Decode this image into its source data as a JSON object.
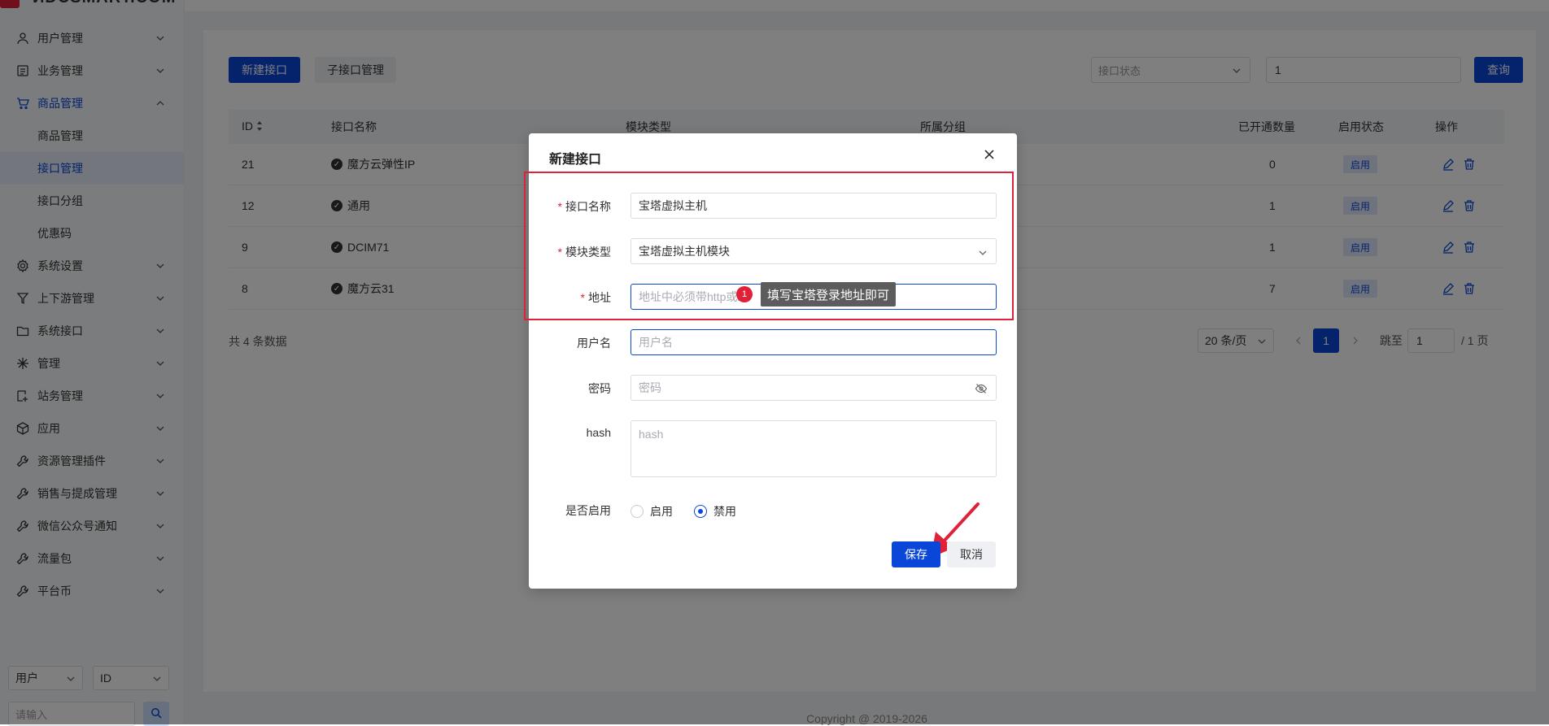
{
  "sidebar": {
    "logo_text": "ИDCSMART.COM",
    "menu": [
      {
        "label": "用户管理",
        "icon": "user-icon"
      },
      {
        "label": "业务管理",
        "icon": "document-icon"
      },
      {
        "label": "商品管理",
        "icon": "cart-icon",
        "open": true,
        "children": [
          "商品管理",
          "接口管理",
          "接口分组",
          "优惠码"
        ],
        "active_child": "接口管理"
      },
      {
        "label": "系统设置",
        "icon": "settings-icon"
      },
      {
        "label": "上下游管理",
        "icon": "filter-icon"
      },
      {
        "label": "系统接口",
        "icon": "folder-icon"
      },
      {
        "label": "管理",
        "icon": "sparkle-icon"
      },
      {
        "label": "站务管理",
        "icon": "site-icon"
      },
      {
        "label": "应用",
        "icon": "box-icon"
      },
      {
        "label": "资源管理插件",
        "icon": "wrench-icon"
      },
      {
        "label": "销售与提成管理",
        "icon": "wrench-icon"
      },
      {
        "label": "微信公众号通知",
        "icon": "wrench-icon"
      },
      {
        "label": "流量包",
        "icon": "wrench-icon"
      },
      {
        "label": "平台币",
        "icon": "wrench-icon"
      }
    ],
    "search_type": "用户",
    "search_field": "ID",
    "search_placeholder": "请输入"
  },
  "toolbar": {
    "new_button": "新建接口",
    "sub_button": "子接口管理",
    "status_placeholder": "接口状态",
    "keyword_value": "1",
    "query_button": "查询"
  },
  "table": {
    "headers": [
      "ID",
      "接口名称",
      "模块类型",
      "所属分组",
      "已开通数量",
      "启用状态",
      "操作"
    ],
    "rows": [
      {
        "id": "21",
        "name": "魔方云弹性IP",
        "count": "0",
        "status": "启用"
      },
      {
        "id": "12",
        "name": "通用",
        "count": "1",
        "status": "启用"
      },
      {
        "id": "9",
        "name": "DCIM71",
        "count": "1",
        "status": "启用"
      },
      {
        "id": "8",
        "name": "魔方云31",
        "count": "7",
        "status": "启用"
      }
    ],
    "total": "共 4 条数据",
    "page_size": "20 条/页",
    "current_page": "1",
    "jump_label": "跳至",
    "jump_value": "1",
    "page_total": "/ 1 页"
  },
  "copyright": "Copyright @ 2019-2026",
  "modal": {
    "title": "新建接口",
    "fields": {
      "name_label": "接口名称",
      "name_value": "宝塔虚拟主机",
      "module_label": "模块类型",
      "module_value": "宝塔虚拟主机模块",
      "address_label": "地址",
      "address_placeholder": "地址中必须带http或h",
      "username_label": "用户名",
      "username_placeholder": "用户名",
      "password_label": "密码",
      "password_placeholder": "密码",
      "hash_label": "hash",
      "hash_placeholder": "hash",
      "enable_label": "是否启用",
      "enable_option": "启用",
      "disable_option": "禁用"
    },
    "save_button": "保存",
    "cancel_button": "取消",
    "tooltip": "填写宝塔登录地址即可",
    "badge": "1"
  },
  "colors": {
    "accent": "#0a46d8",
    "highlight": "#e0213a"
  }
}
